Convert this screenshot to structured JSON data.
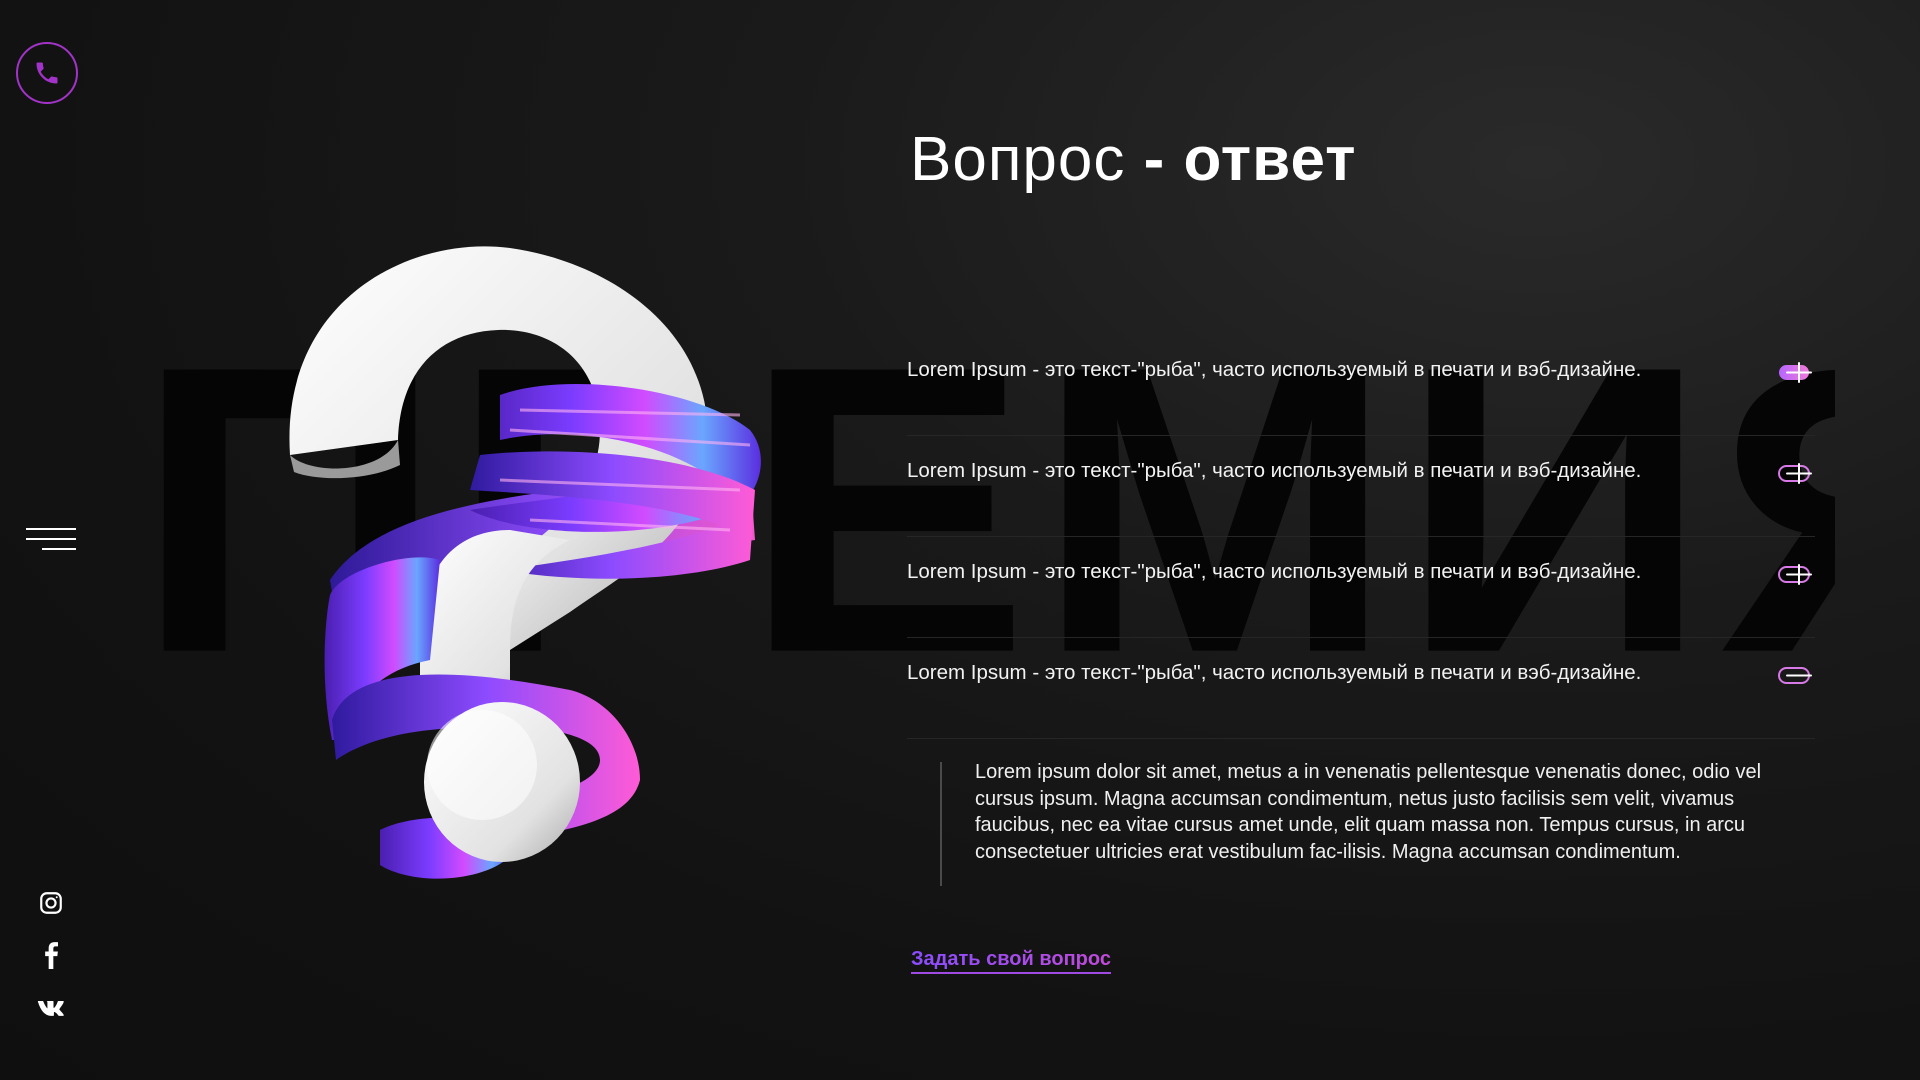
{
  "colors": {
    "accent": "#a233c8",
    "link_gradient": [
      "#8a4dff",
      "#c04bd8"
    ],
    "background": "#141414"
  },
  "icons": {
    "phone": "phone-icon",
    "menu": "hamburger-menu-icon",
    "instagram": "instagram-icon",
    "facebook": "facebook-icon",
    "vk": "vk-icon",
    "toggle": "plus-toggle-icon"
  },
  "background_word": "ПРЕМИЯ",
  "title": {
    "regular": "Вопрос",
    "bold": " - ответ"
  },
  "faq": {
    "items": [
      {
        "question": "Lorem Ipsum - это текст-\"рыба\", часто используемый в печати и вэб-дизайне.",
        "expanded": false
      },
      {
        "question": "Lorem Ipsum - это текст-\"рыба\", часто используемый в печати и вэб-дизайне.",
        "expanded": false
      },
      {
        "question": "Lorem Ipsum - это текст-\"рыба\", часто используемый в печати и вэб-дизайне.",
        "expanded": false
      },
      {
        "question": "Lorem Ipsum - это текст-\"рыба\", часто используемый в печати и вэб-дизайне.",
        "expanded": true
      }
    ],
    "answer": "Lorem ipsum dolor sit amet, metus a in venenatis pellentesque venenatis donec, odio vel cursus ipsum. Magna accumsan condimentum, netus justo facilisis sem velit, vivamus faucibus, nec ea vitae cursus amet unde, elit quam massa non. Tempus cursus, in arcu consectetuer ultricies erat vestibulum fac-ilisis. Magna accumsan condimentum."
  },
  "ask_link": "Задать свой вопрос"
}
